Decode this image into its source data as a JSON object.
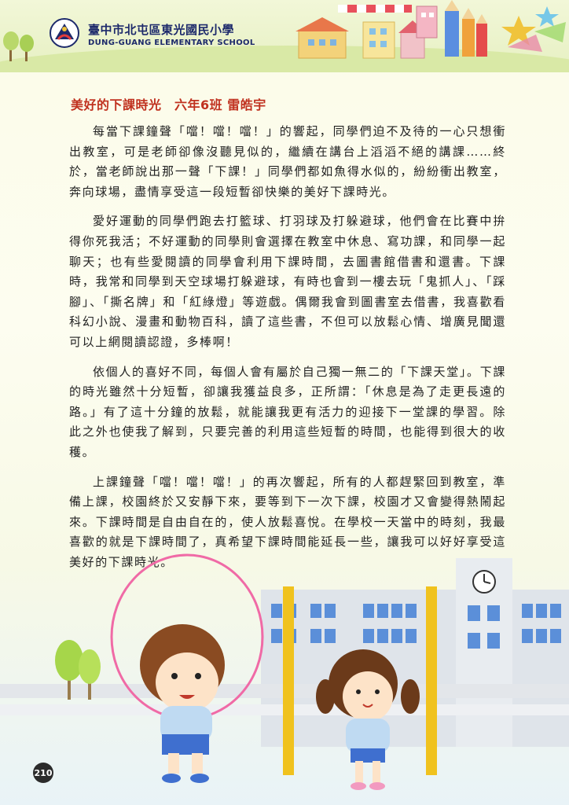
{
  "header": {
    "school_name_zh": "臺中市北屯區東光國民小學",
    "school_name_en": "DUNG-GUANG ELEMENTARY SCHOOL"
  },
  "article": {
    "title": "美好的下課時光　六年6班 雷皓宇",
    "paragraphs": [
      "每當下課鐘聲「噹！噹！噹！」的響起，同學們迫不及待的一心只想衝出教室，可是老師卻像沒聽見似的，繼續在講台上滔滔不絕的講課……終於，當老師說出那一聲「下課！」同學們都如魚得水似的，紛紛衝出教室，奔向球場，盡情享受這一段短暫卻快樂的美好下課時光。",
      "愛好運動的同學們跑去打籃球、打羽球及打躲避球，他們會在比賽中拚得你死我活；不好運動的同學則會選擇在教室中休息、寫功課，和同學一起聊天；也有些愛閱讀的同學會利用下課時間，去圖書館借書和還書。下課時，我常和同學到天空球場打躲避球，有時也會到一樓去玩「鬼抓人」、「踩腳」、「撕名牌」和「紅綠燈」等遊戲。偶爾我會到圖書室去借書，我喜歡看科幻小說、漫畫和動物百科，讀了這些書，不但可以放鬆心情、增廣見聞還可以上網閱讀認證，多棒啊！",
      "依個人的喜好不同，每個人會有屬於自己獨一無二的「下課天堂」。下課的時光雖然十分短暫，卻讓我獲益良多，正所謂：「休息是為了走更長遠的路。」有了這十分鐘的放鬆，就能讓我更有活力的迎接下一堂課的學習。除此之外也使我了解到，只要完善的利用這些短暫的時間，也能得到很大的收穫。",
      "上課鐘聲「噹！噹！噹！」的再次響起，所有的人都趕緊回到教室，準備上課，校園終於又安靜下來，要等到下一次下課，校園才又會變得熱鬧起來。下課時間是自由自在的，使人放鬆喜悅。在學校一天當中的時刻，我最喜歡的就是下課時間了，真希望下課時間能延長一些，讓我可以好好享受這美好的下課時光。"
    ]
  },
  "page_number": "210",
  "colors": {
    "title": "#c0311f",
    "school_name": "#1d2a6b",
    "body_text": "#222222"
  }
}
